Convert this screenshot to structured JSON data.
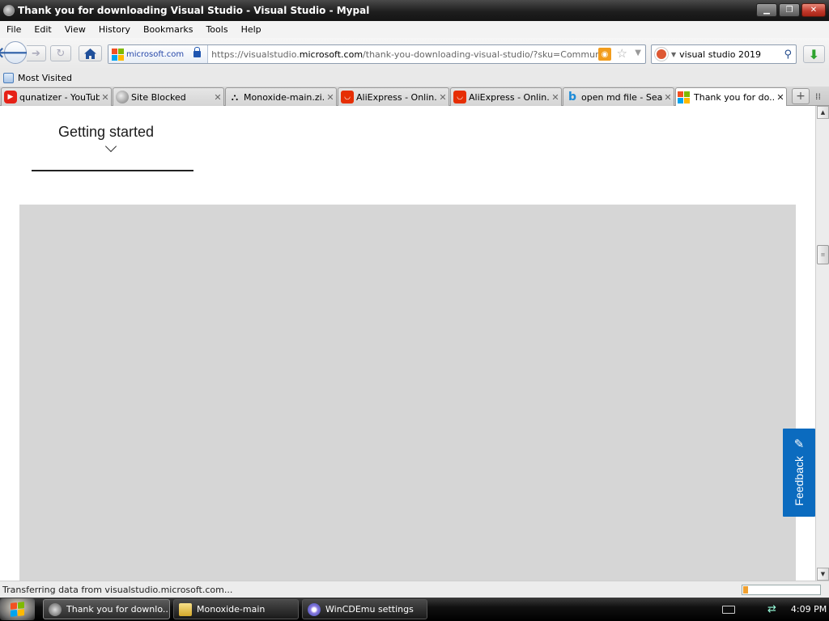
{
  "window": {
    "title": "Thank you for downloading Visual Studio - Visual Studio - Mypal"
  },
  "menu": [
    "File",
    "Edit",
    "View",
    "History",
    "Bookmarks",
    "Tools",
    "Help"
  ],
  "urlbar": {
    "identity": "microsoft.com",
    "url_prefix": "https://visualstudio.",
    "url_domain": "microsoft.com",
    "url_suffix": "/thank-you-downloading-visual-studio/?sku=Community&channel=R"
  },
  "search": {
    "value": "visual studio 2019"
  },
  "bookmarks": {
    "most_visited": "Most Visited"
  },
  "tabs": [
    {
      "label": "qunatizer - YouTube",
      "icon": "youtube-icon"
    },
    {
      "label": "Site Blocked",
      "icon": "globe-icon"
    },
    {
      "label": "Monoxide-main.zi...",
      "icon": "github-icon"
    },
    {
      "label": "AliExpress - Onlin...",
      "icon": "aliexpress-icon"
    },
    {
      "label": "AliExpress - Onlin...",
      "icon": "aliexpress-icon"
    },
    {
      "label": "open md file - Sea...",
      "icon": "bing-icon"
    },
    {
      "label": "Thank you for do...",
      "icon": "microsoft-icon",
      "active": true
    }
  ],
  "page": {
    "getting_started": "Getting started",
    "feedback": "Feedback"
  },
  "status": {
    "text": "Transferring data from visualstudio.microsoft.com...",
    "progress": 0.06
  },
  "taskbar": {
    "items": [
      {
        "label": "Thank you for downlo...",
        "icon": "mypal-icon",
        "active": true
      },
      {
        "label": "Monoxide-main",
        "icon": "folder-icon"
      },
      {
        "label": "WinCDEmu settings",
        "icon": "wincdemu-icon"
      }
    ],
    "clock": "4:09 PM"
  },
  "colors": {
    "accent": "#0b6bbf",
    "ms_red": "#f25022",
    "ms_green": "#7fba00",
    "ms_blue": "#00a4ef",
    "ms_yellow": "#ffb900"
  }
}
